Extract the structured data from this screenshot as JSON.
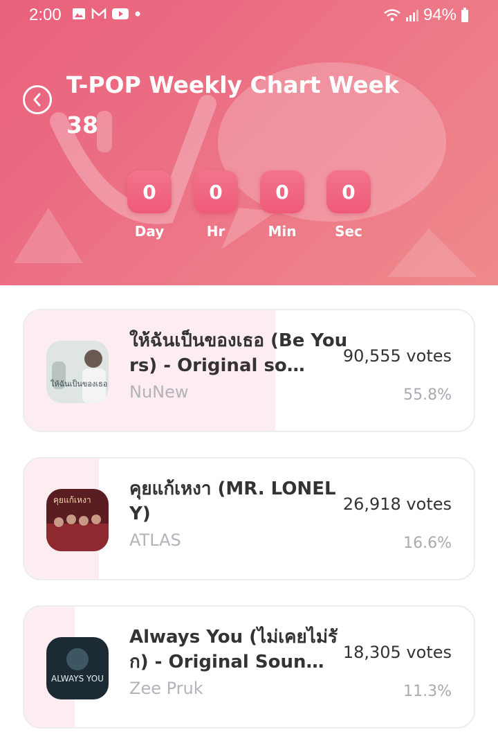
{
  "status_bar": {
    "time": "2:00",
    "battery": "94%"
  },
  "header": {
    "title": "T-POP Weekly Chart Week 38",
    "countdown": [
      {
        "value": "0",
        "label": "Day"
      },
      {
        "value": "0",
        "label": "Hr"
      },
      {
        "value": "0",
        "label": "Min"
      },
      {
        "value": "0",
        "label": "Sec"
      }
    ]
  },
  "colors": {
    "accent": "#ec6682",
    "bar_fill": "#fdecf0"
  },
  "entries": [
    {
      "title": "ให้ฉันเป็นของเธอ (Be Yours) - Original so…",
      "artist": "NuNew",
      "votes": "90,555 votes",
      "percent": "55.8%",
      "share": 55.8,
      "cover_text": "ให้ฉันเป็นของเธอ"
    },
    {
      "title": "คุยแก้เหงา (MR. LONELY)",
      "artist": "ATLAS",
      "votes": "26,918 votes",
      "percent": "16.6%",
      "share": 16.6,
      "cover_text": "คุยแก้เหงา"
    },
    {
      "title": "Always You (ไม่เคยไม่รัก) - Original Soun…",
      "artist": "Zee Pruk",
      "votes": "18,305 votes",
      "percent": "11.3%",
      "share": 11.3,
      "cover_text": "ALWAYS YOU"
    }
  ]
}
